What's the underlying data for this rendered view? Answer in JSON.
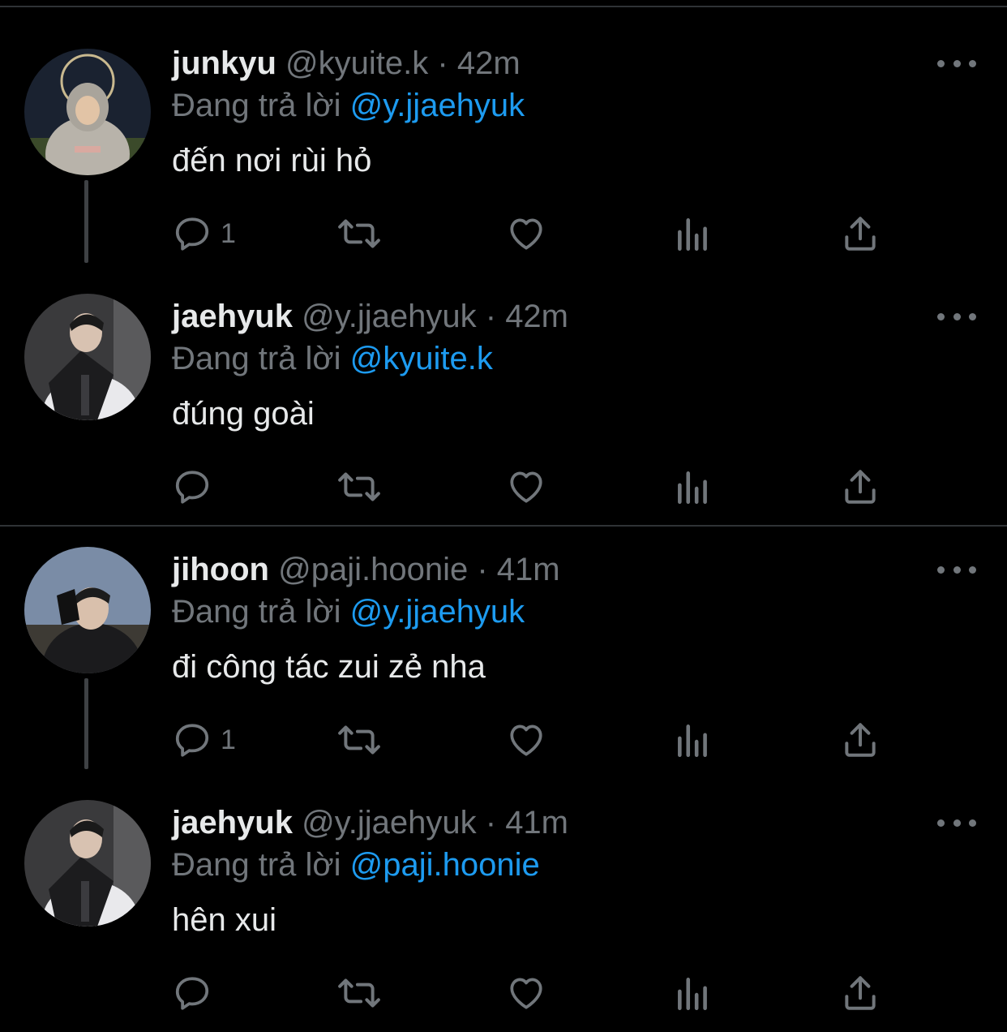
{
  "tweets": [
    {
      "name": "junkyu",
      "handle": "@kyuite.k",
      "dot": "·",
      "time": "42m",
      "reply_prefix": "Đang trả lời",
      "reply_to": "@y.jjaehyuk",
      "text": "đến nơi rùi hỏ",
      "reply_count": "1",
      "avatar": "avatar-junkyu"
    },
    {
      "name": "jaehyuk",
      "handle": "@y.jjaehyuk",
      "dot": "·",
      "time": "42m",
      "reply_prefix": "Đang trả lời",
      "reply_to": "@kyuite.k",
      "text": "đúng goài",
      "reply_count": "",
      "avatar": "avatar-jaehyuk"
    },
    {
      "name": "jihoon",
      "handle": "@paji.hoonie",
      "dot": "·",
      "time": "41m",
      "reply_prefix": "Đang trả lời",
      "reply_to": "@y.jjaehyuk",
      "text": "đi công tác zui zẻ nha",
      "reply_count": "1",
      "avatar": "avatar-jihoon"
    },
    {
      "name": "jaehyuk",
      "handle": "@y.jjaehyuk",
      "dot": "·",
      "time": "41m",
      "reply_prefix": "Đang trả lời",
      "reply_to": "@paji.hoonie",
      "text": "hên xui",
      "reply_count": "",
      "avatar": "avatar-jaehyuk"
    }
  ],
  "icons": {
    "reply": "reply-icon",
    "retweet": "retweet-icon",
    "like": "heart-icon",
    "views": "views-icon",
    "share": "share-icon",
    "more": "more-icon"
  },
  "colors": {
    "background": "#000000",
    "text": "#e7e9ea",
    "muted": "#71767b",
    "mention": "#1d9bf0",
    "divider": "#2f3336"
  }
}
